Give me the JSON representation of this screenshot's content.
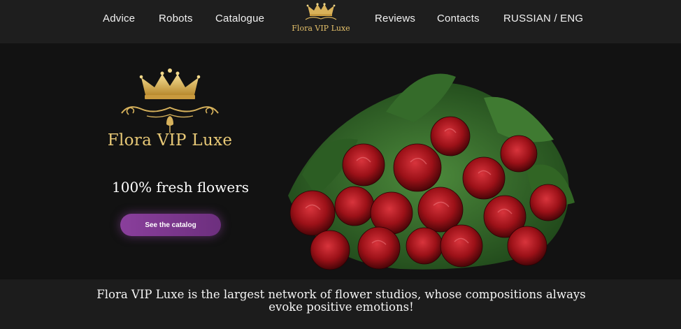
{
  "nav": {
    "items": [
      {
        "label": "Advice"
      },
      {
        "label": "Robots"
      },
      {
        "label": "Catalogue"
      },
      {
        "label": "Reviews"
      },
      {
        "label": "Contacts"
      },
      {
        "label": "RUSSIAN / ENG"
      }
    ],
    "logo_text": "Flora VIP Luxe"
  },
  "hero": {
    "logo_text": "Flora VIP Luxe",
    "tagline": "100% fresh flowers",
    "cta_label": "See the catalog"
  },
  "description": "Flora VIP Luxe is the largest network of flower studios, whose compositions always evoke positive emotions!",
  "colors": {
    "gold": "#e4c06a",
    "button": "#7a3689",
    "rose": "#a5141c",
    "leaf": "#2f6a2b"
  },
  "icons": {
    "crown": "crown-icon",
    "ornament": "flourish-ornament-icon",
    "rose_bud": "rose-bud-icon"
  }
}
